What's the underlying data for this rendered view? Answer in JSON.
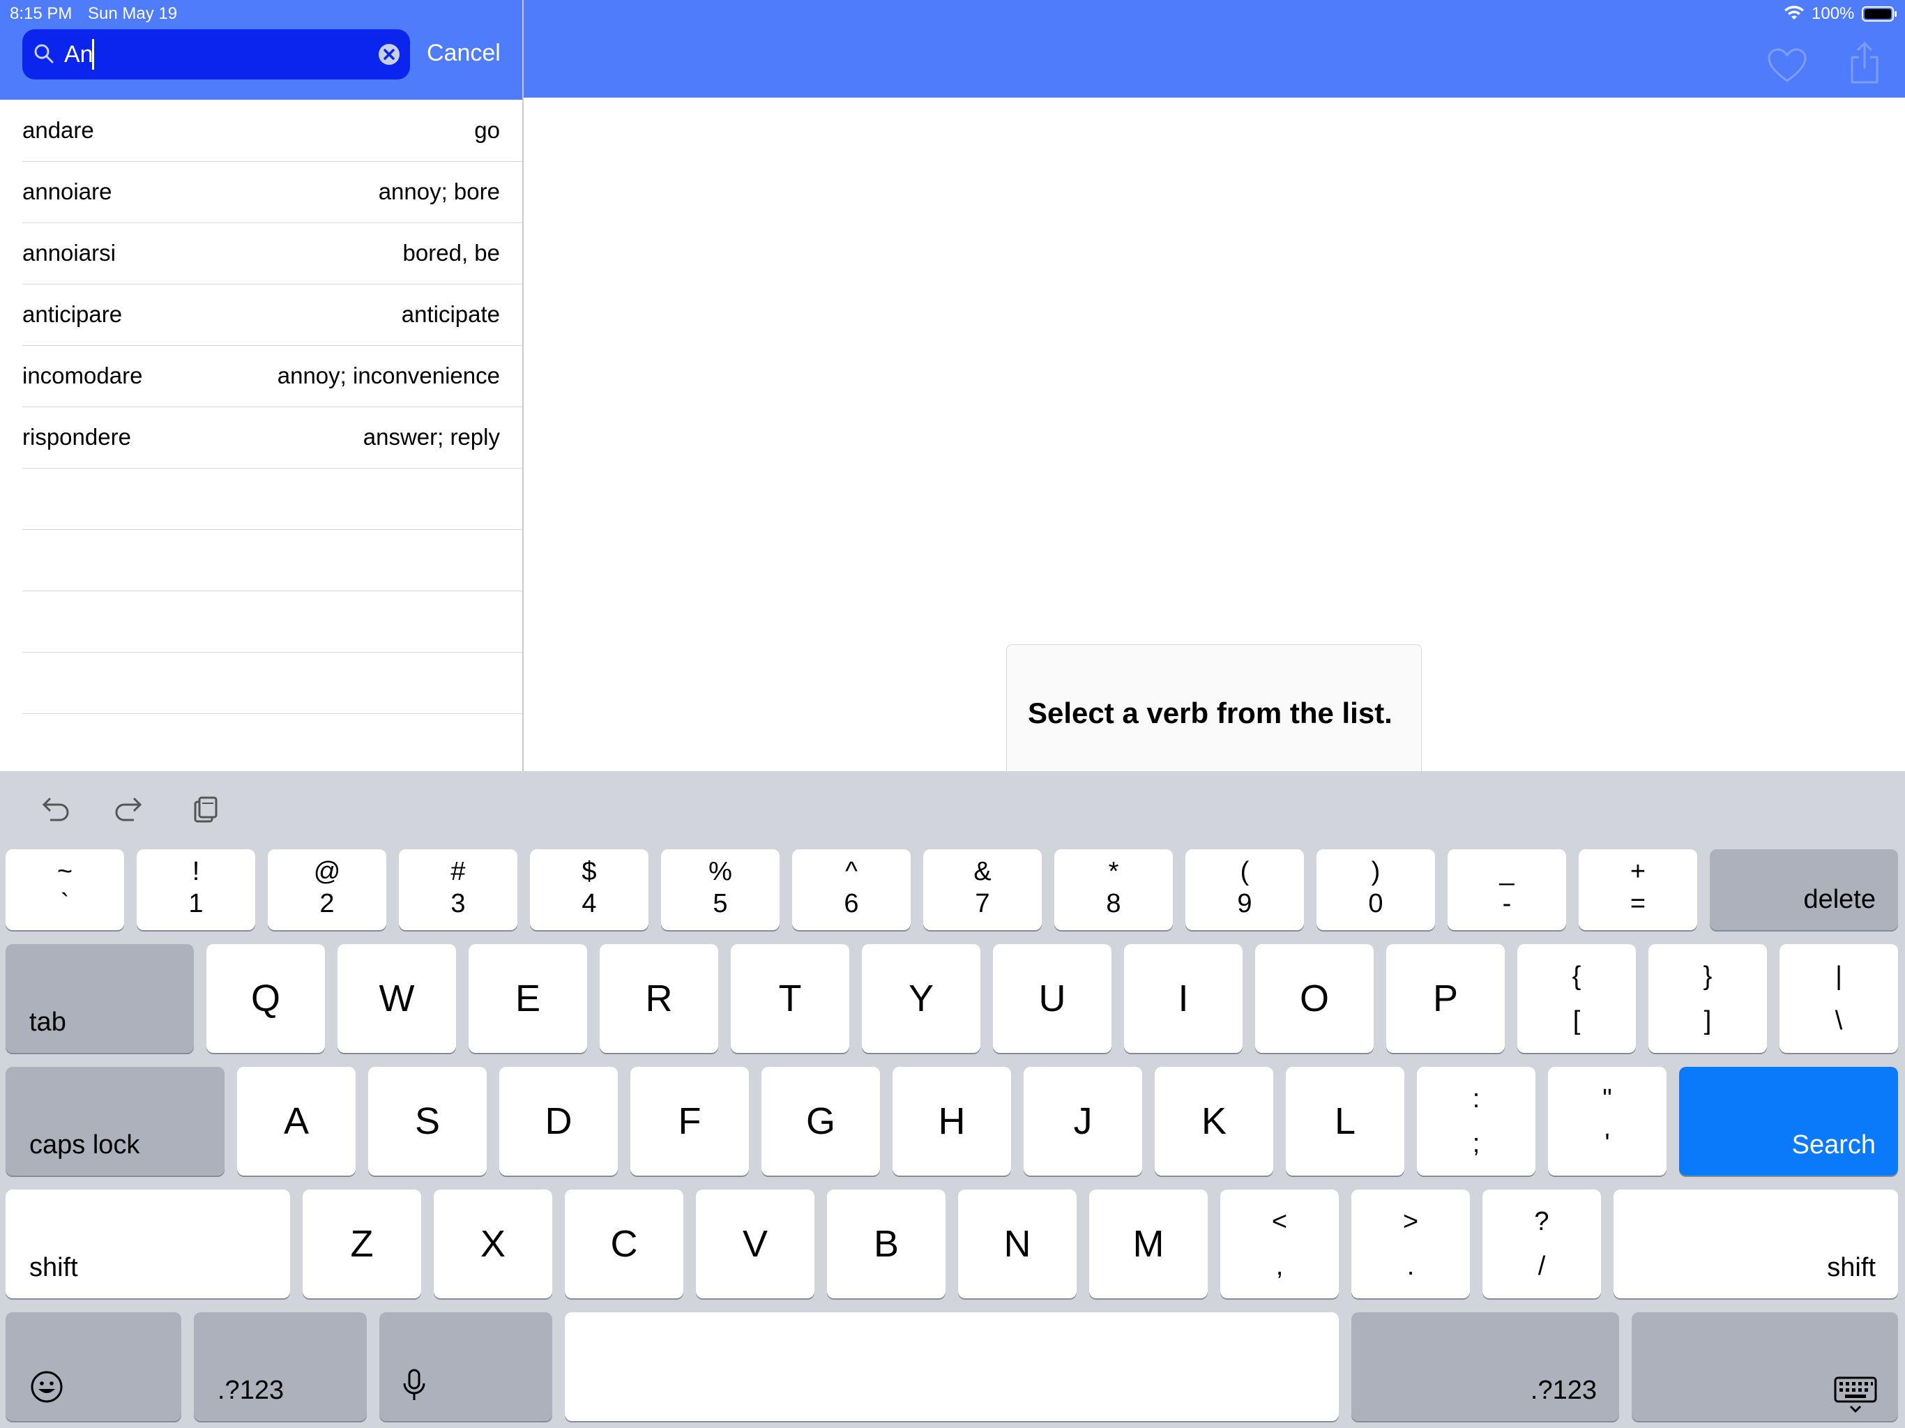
{
  "status_bar": {
    "time": "8:15 PM",
    "date": "Sun May 19",
    "battery": "100%"
  },
  "search": {
    "value": "An",
    "cancel_label": "Cancel"
  },
  "results": [
    {
      "verb": "andare",
      "meaning": "go"
    },
    {
      "verb": "annoiare",
      "meaning": "annoy; bore"
    },
    {
      "verb": "annoiarsi",
      "meaning": "bored, be"
    },
    {
      "verb": "anticipare",
      "meaning": "anticipate"
    },
    {
      "verb": "incomodare",
      "meaning": "annoy; inconvenience"
    },
    {
      "verb": "rispondere",
      "meaning": "answer; reply"
    }
  ],
  "detail": {
    "message": "Select a verb from the list."
  },
  "colors": {
    "header": "#4f7cfa",
    "search_field": "#0b24ee",
    "search_key": "#0a79fa",
    "keyboard_bg": "#d1d4db"
  },
  "keyboard": {
    "number_row": [
      {
        "top": "~",
        "bottom": "`"
      },
      {
        "top": "!",
        "bottom": "1"
      },
      {
        "top": "@",
        "bottom": "2"
      },
      {
        "top": "#",
        "bottom": "3"
      },
      {
        "top": "$",
        "bottom": "4"
      },
      {
        "top": "%",
        "bottom": "5"
      },
      {
        "top": "^",
        "bottom": "6"
      },
      {
        "top": "&",
        "bottom": "7"
      },
      {
        "top": "*",
        "bottom": "8"
      },
      {
        "top": "(",
        "bottom": "9"
      },
      {
        "top": ")",
        "bottom": "0"
      },
      {
        "top": "_",
        "bottom": "-"
      },
      {
        "top": "+",
        "bottom": "="
      }
    ],
    "delete_label": "delete",
    "tab_label": "tab",
    "row_q": [
      "Q",
      "W",
      "E",
      "R",
      "T",
      "Y",
      "U",
      "I",
      "O",
      "P"
    ],
    "row_q_symbols": [
      {
        "top": "{",
        "bottom": "["
      },
      {
        "top": "}",
        "bottom": "]"
      },
      {
        "top": "|",
        "bottom": "\\"
      }
    ],
    "caps_label": "caps lock",
    "row_a": [
      "A",
      "S",
      "D",
      "F",
      "G",
      "H",
      "J",
      "K",
      "L"
    ],
    "row_a_symbols": [
      {
        "top": ":",
        "bottom": ";"
      },
      {
        "top": "\"",
        "bottom": "'"
      }
    ],
    "search_label": "Search",
    "shift_label": "shift",
    "row_z": [
      "Z",
      "X",
      "C",
      "V",
      "B",
      "N",
      "M"
    ],
    "row_z_symbols": [
      {
        "top": "<",
        "bottom": ","
      },
      {
        "top": ">",
        "bottom": "."
      },
      {
        "top": "?",
        "bottom": "/"
      }
    ],
    "numbers_label": ".?123",
    "toolbar_icons": [
      "undo-icon",
      "redo-icon",
      "paste-icon"
    ]
  }
}
